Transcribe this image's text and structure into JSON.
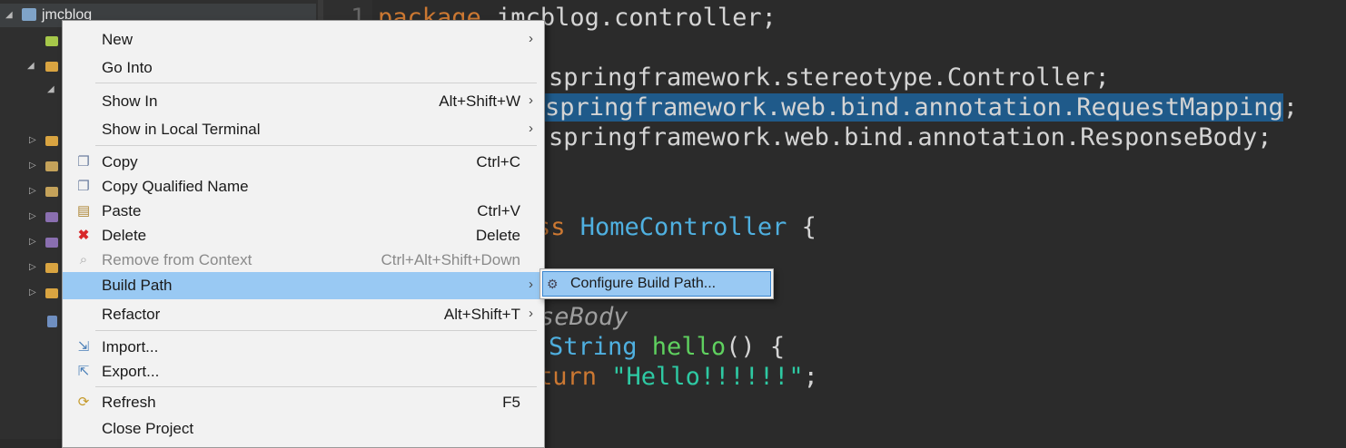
{
  "explorer": {
    "project_name": "jmcblog"
  },
  "editor": {
    "line_number": "1",
    "lines": {
      "l1_kw": "package",
      "l1_rest": " jmcblog.controller;",
      "l2": "springframework.stereotype.Controller;",
      "l3_sel": "springframework.web.bind.annotation.RequestMapping",
      "l3_end": ";",
      "l4": "springframework.web.bind.annotation.ResponseBody;",
      "l5_kw": "ss",
      "l5_type": " HomeController",
      "l5_end": " {",
      "l6_ann": "seBody",
      "l7_type": "String",
      "l7_fn": " hello",
      "l7_end": "() {",
      "l8_kw": "turn",
      "l8_str": " \"Hello!!!!!!\"",
      "l8_end": ";"
    }
  },
  "context_menu": {
    "items": {
      "new": {
        "label": "New"
      },
      "go_into": {
        "label": "Go Into"
      },
      "show_in": {
        "label": "Show In",
        "shortcut": "Alt+Shift+W"
      },
      "show_in_terminal": {
        "label": "Show in Local Terminal"
      },
      "copy": {
        "label": "Copy",
        "shortcut": "Ctrl+C",
        "icon": "copy-icon"
      },
      "copy_qualified": {
        "label": "Copy Qualified Name",
        "icon": "copy-qualified-icon"
      },
      "paste": {
        "label": "Paste",
        "shortcut": "Ctrl+V",
        "icon": "paste-icon"
      },
      "delete": {
        "label": "Delete",
        "shortcut": "Delete",
        "icon": "delete-icon"
      },
      "remove_context": {
        "label": "Remove from Context",
        "shortcut": "Ctrl+Alt+Shift+Down",
        "icon": "remove-context-icon"
      },
      "build_path": {
        "label": "Build Path"
      },
      "refactor": {
        "label": "Refactor",
        "shortcut": "Alt+Shift+T"
      },
      "import": {
        "label": "Import...",
        "icon": "import-icon"
      },
      "export": {
        "label": "Export...",
        "icon": "export-icon"
      },
      "refresh": {
        "label": "Refresh",
        "shortcut": "F5",
        "icon": "refresh-icon"
      },
      "close_project": {
        "label": "Close Project"
      }
    },
    "arrow": "›"
  },
  "submenu": {
    "configure_build_path": {
      "label": "Configure Build Path...",
      "icon": "build-path-icon"
    }
  },
  "colors": {
    "highlight": "#99c9f3",
    "selection": "#1f5a8a",
    "keyword": "#cc7832",
    "type": "#4fb0e0"
  }
}
